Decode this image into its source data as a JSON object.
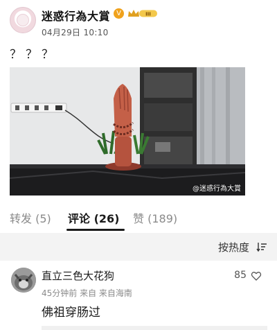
{
  "post": {
    "author_name": "迷惑行為大賞",
    "verified_badge": "V",
    "vip_badge": "III",
    "timestamp": "04月29日 10:10",
    "text": "？？？",
    "media": {
      "watermark": "@迷惑行為大賞"
    }
  },
  "tabs": [
    {
      "label": "转发 (5)",
      "active": false
    },
    {
      "label": "评论 (26)",
      "active": true
    },
    {
      "label": "赞 (189)",
      "active": false
    }
  ],
  "sort": {
    "label": "按热度"
  },
  "comments": [
    {
      "author": "直立三色大花狗",
      "meta": "45分钟前 来自 来自海南",
      "likes": "85",
      "text": "佛祖穿肠过"
    }
  ],
  "colors": {
    "active_tab": "#1a1a1a",
    "inactive_tab": "#8a8a8a",
    "verified": "#f0a21d",
    "vip": "#f3c84b",
    "sort_bg": "#f3f3f3"
  }
}
